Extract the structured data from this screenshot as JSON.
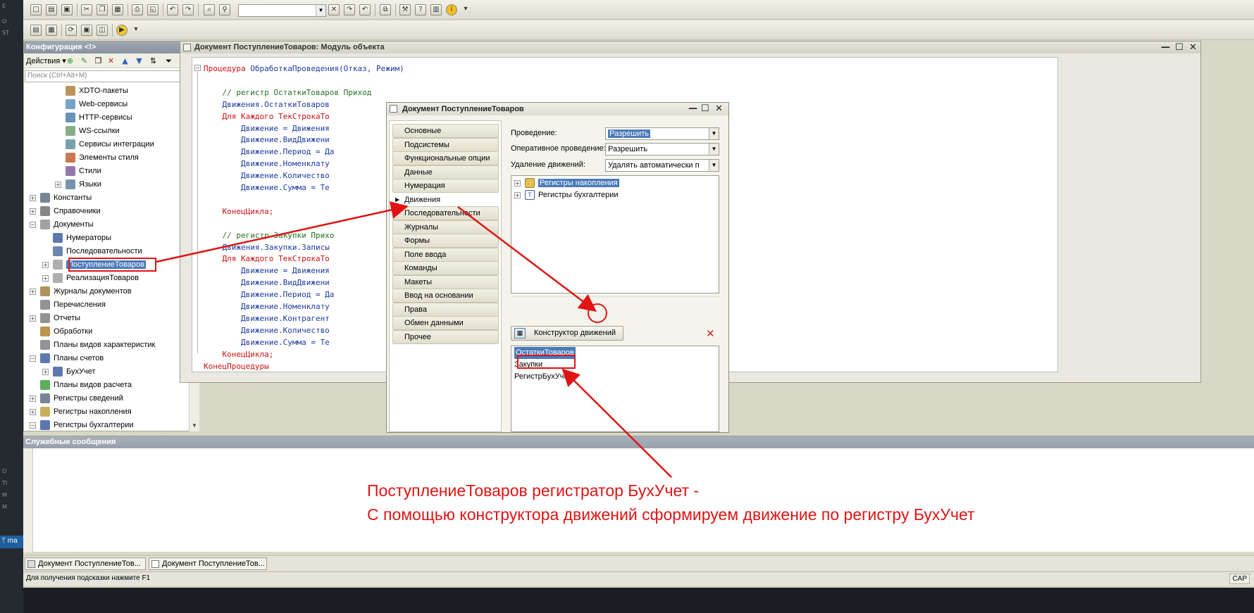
{
  "host": {
    "side_labels": [
      "E",
      "O",
      "ST",
      "O",
      "TI",
      "M",
      "M"
    ],
    "branch": "ma"
  },
  "toolbar": {
    "search_value": ""
  },
  "config_panel": {
    "title": "Конфигурация <!>",
    "actions_label": "Действия",
    "search_placeholder": "Поиск (Ctrl+Alt+M)",
    "tree": [
      {
        "label": "XDTO-пакеты",
        "level": 2,
        "icon": "xdto-icon",
        "color": "#b08040"
      },
      {
        "label": "Web-сервисы",
        "level": 2,
        "icon": "web-service-icon",
        "color": "#6090c0"
      },
      {
        "label": "HTTP-сервисы",
        "level": 2,
        "icon": "http-service-icon",
        "color": "#5080b0"
      },
      {
        "label": "WS-ссылки",
        "level": 2,
        "icon": "ws-link-icon",
        "color": "#70a070"
      },
      {
        "label": "Сервисы интеграции",
        "level": 2,
        "icon": "integration-icon",
        "color": "#6090a0"
      },
      {
        "label": "Элементы стиля",
        "level": 2,
        "icon": "style-element-icon",
        "color": "#c06030"
      },
      {
        "label": "Стили",
        "level": 2,
        "icon": "style-icon",
        "color": "#8060a0"
      },
      {
        "label": "Языки",
        "level": 2,
        "icon": "language-icon",
        "color": "#6080a0",
        "expand": true
      },
      {
        "label": "Константы",
        "level": 0,
        "icon": "constant-icon",
        "color": "#607080",
        "expand": true
      },
      {
        "label": "Справочники",
        "level": 0,
        "icon": "catalog-icon",
        "color": "#707070",
        "expand": true
      },
      {
        "label": "Документы",
        "level": 0,
        "icon": "document-icon",
        "color": "#909090",
        "expand": true,
        "expanded": true
      },
      {
        "label": "Нумераторы",
        "level": 1,
        "icon": "numerator-icon",
        "color": "#4060a0"
      },
      {
        "label": "Последовательности",
        "level": 1,
        "icon": "sequence-icon",
        "color": "#5070a0"
      },
      {
        "label": "ПоступлениеТоваров",
        "level": 1,
        "icon": "document-item-icon",
        "color": "#a0a0a0",
        "expand": true,
        "selected": true
      },
      {
        "label": "РеализацияТоваров",
        "level": 1,
        "icon": "document-item-icon",
        "color": "#a0a0a0",
        "expand": true
      },
      {
        "label": "Журналы документов",
        "level": 0,
        "icon": "journal-icon",
        "color": "#a08040",
        "expand": true
      },
      {
        "label": "Перечисления",
        "level": 0,
        "icon": "enum-icon",
        "color": "#808080"
      },
      {
        "label": "Отчеты",
        "level": 0,
        "icon": "report-icon",
        "color": "#808080",
        "expand": true
      },
      {
        "label": "Обработки",
        "level": 0,
        "icon": "processing-icon",
        "color": "#b08030"
      },
      {
        "label": "Планы видов характеристик",
        "level": 0,
        "icon": "char-types-icon",
        "color": "#808080"
      },
      {
        "label": "Планы счетов",
        "level": 0,
        "icon": "chart-of-accounts-icon",
        "color": "#4060a0",
        "expand": true,
        "expanded": true
      },
      {
        "label": "БухУчет",
        "level": 1,
        "icon": "accounts-item-icon",
        "color": "#4060a0",
        "expand": true
      },
      {
        "label": "Планы видов расчета",
        "level": 0,
        "icon": "calc-types-icon",
        "color": "#40a040"
      },
      {
        "label": "Регистры сведений",
        "level": 0,
        "icon": "info-register-icon",
        "color": "#607080",
        "expand": true
      },
      {
        "label": "Регистры накопления",
        "level": 0,
        "icon": "accumulation-register-icon",
        "color": "#c0a040",
        "expand": true
      },
      {
        "label": "Регистры бухгалтерии",
        "level": 0,
        "icon": "accounting-register-icon",
        "color": "#4060a0",
        "expand": true,
        "expanded": true
      }
    ]
  },
  "module_window": {
    "title": "Документ ПоступлениеТоваров: Модуль объекта",
    "code": [
      {
        "parts": [
          {
            "t": "Процедура",
            "c": "kw"
          },
          {
            "t": " ОбработкаПроведения(Отказ, Режим)",
            "c": "id"
          }
        ]
      },
      {
        "parts": []
      },
      {
        "parts": [
          {
            "t": "    // регистр ОстаткиТоваров Приход",
            "c": "cm"
          }
        ]
      },
      {
        "parts": [
          {
            "t": "    Движения.ОстаткиТоваров",
            "c": "id"
          }
        ]
      },
      {
        "parts": [
          {
            "t": "    Для Каждого ТекСтрокаТо",
            "c": "kw"
          }
        ]
      },
      {
        "parts": [
          {
            "t": "        Движение = Движения",
            "c": "id"
          }
        ]
      },
      {
        "parts": [
          {
            "t": "        Движение.ВидДвижени",
            "c": "id"
          }
        ]
      },
      {
        "parts": [
          {
            "t": "        Движение.Период = Да",
            "c": "id"
          }
        ]
      },
      {
        "parts": [
          {
            "t": "        Движение.Номенклату",
            "c": "id"
          }
        ]
      },
      {
        "parts": [
          {
            "t": "        Движение.Количество",
            "c": "id"
          }
        ]
      },
      {
        "parts": [
          {
            "t": "        Движение.Сумма = Те",
            "c": "id"
          }
        ]
      },
      {
        "parts": []
      },
      {
        "parts": [
          {
            "t": "    КонецЦикла;",
            "c": "kw"
          }
        ]
      },
      {
        "parts": []
      },
      {
        "parts": [
          {
            "t": "    // регистр Закупки Прихо",
            "c": "cm"
          }
        ]
      },
      {
        "parts": [
          {
            "t": "    Движения.Закупки.Записы",
            "c": "id"
          }
        ]
      },
      {
        "parts": [
          {
            "t": "    Для Каждого ТекСтрокаТо",
            "c": "kw"
          }
        ]
      },
      {
        "parts": [
          {
            "t": "        Движение = Движения",
            "c": "id"
          }
        ]
      },
      {
        "parts": [
          {
            "t": "        Движение.ВидДвижени",
            "c": "id"
          }
        ]
      },
      {
        "parts": [
          {
            "t": "        Движение.Период = Да",
            "c": "id"
          }
        ]
      },
      {
        "parts": [
          {
            "t": "        Движение.Номенклату",
            "c": "id"
          }
        ]
      },
      {
        "parts": [
          {
            "t": "        Движение.Контрагент",
            "c": "id"
          }
        ]
      },
      {
        "parts": [
          {
            "t": "        Движение.Количество",
            "c": "id"
          }
        ]
      },
      {
        "parts": [
          {
            "t": "        Движение.Сумма = Те",
            "c": "id"
          }
        ]
      },
      {
        "parts": [
          {
            "t": "    КонецЦикла;",
            "c": "kw"
          }
        ]
      },
      {
        "parts": [
          {
            "t": "КонецПроцедуры",
            "c": "kw"
          }
        ]
      }
    ]
  },
  "doc_dialog": {
    "title": "Документ ПоступлениеТоваров",
    "nav": [
      "Основные",
      "Подсистемы",
      "Функциональные опции",
      "Данные",
      "Нумерация",
      "Движения",
      "Последовательности",
      "Журналы",
      "Формы",
      "Поле ввода",
      "Команды",
      "Макеты",
      "Ввод на основании",
      "Права",
      "Обмен данными",
      "Прочее"
    ],
    "active_nav": "Движения",
    "fields": [
      {
        "label": "Проведение:",
        "value": "Разрешить",
        "highlight": true
      },
      {
        "label": "Оперативное проведение:",
        "value": "Разрешить"
      },
      {
        "label": "Удаление движений:",
        "value": "Удалять автоматически п"
      }
    ],
    "register_tree": [
      {
        "label": "Регистры накопления",
        "icon": "accumulation-register-icon",
        "selected": true
      },
      {
        "label": "Регистры бухгалтерии",
        "icon": "accounting-register-icon"
      }
    ],
    "movements_button": "Конструктор движений",
    "movements": [
      {
        "label": "ОстаткиТоваров",
        "selected": true
      },
      {
        "label": "Закупки"
      },
      {
        "label": "РегистрБухУчет"
      }
    ]
  },
  "service_messages": {
    "title": "Служебные сообщения"
  },
  "annotation": {
    "line1": "ПоступлениеТоваров регистратор БухУчет -",
    "line2": "С помощью конструктора движений сформируем движение по регистру БухУчет",
    "color": "#e01414"
  },
  "tasks": [
    "Документ ПоступлениеТов...",
    "Документ ПоступлениеТов..."
  ],
  "status": {
    "hint": "Для получения подсказки нажмите F1",
    "cap": "CAP"
  }
}
